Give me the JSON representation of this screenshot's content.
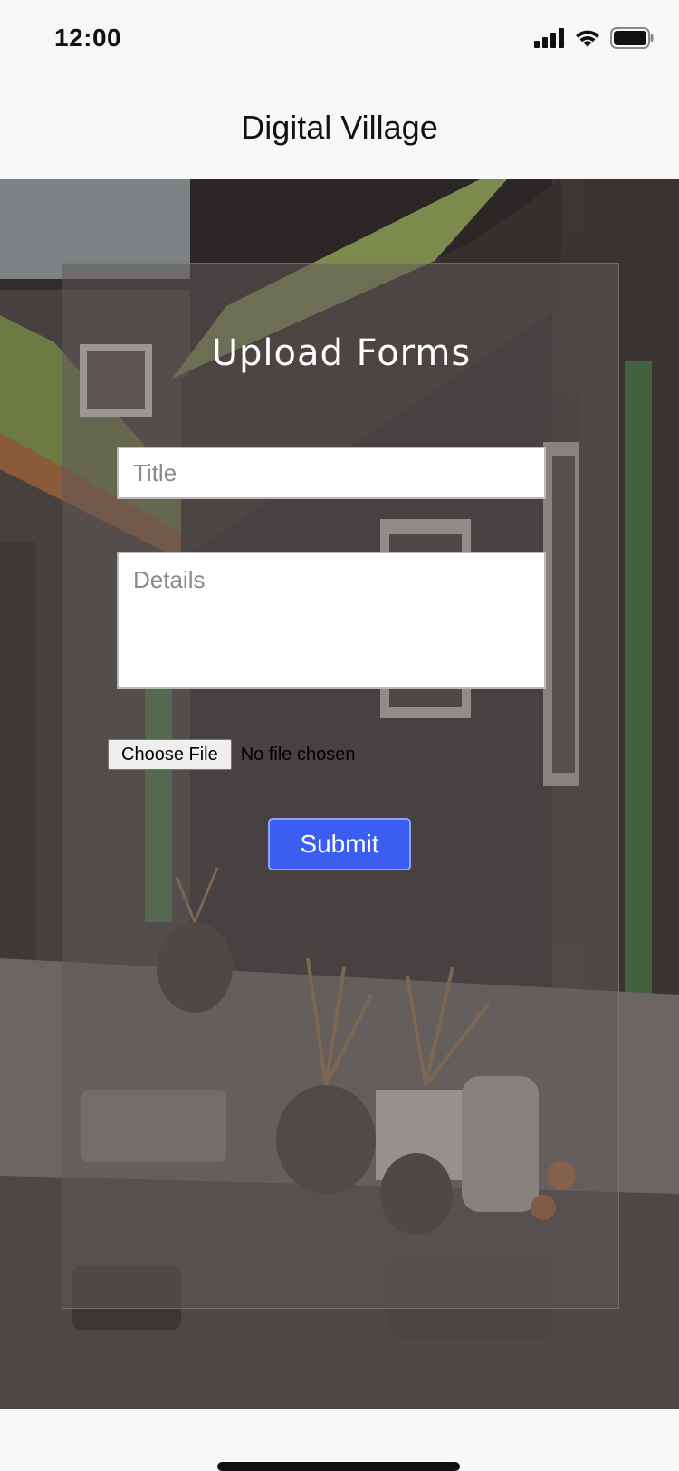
{
  "status_bar": {
    "time": "12:00",
    "icons": [
      "cellular-signal-icon",
      "wifi-icon",
      "battery-icon"
    ]
  },
  "header": {
    "title": "Digital Village"
  },
  "form": {
    "title": "Upload Forms",
    "title_field": {
      "placeholder": "Title",
      "value": ""
    },
    "details_field": {
      "placeholder": "Details",
      "value": ""
    },
    "file_picker": {
      "button_label": "Choose File",
      "status": "No file chosen"
    },
    "submit_label": "Submit"
  },
  "colors": {
    "submit_background": "#3b5ef0",
    "page_background": "#f7f7f7",
    "card_overlay": "rgba(95,90,88,0.55)"
  }
}
